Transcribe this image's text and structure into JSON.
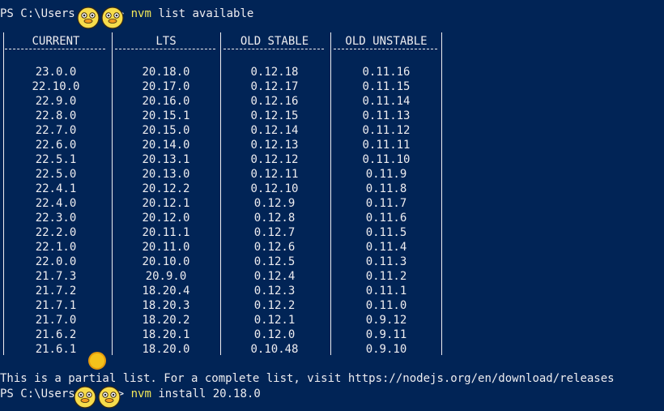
{
  "terminal": {
    "prompt_prefix": "PS C:\\Users",
    "prompt_suffix": ">",
    "command1": {
      "program": "nvm",
      "args": "list available"
    },
    "command2": {
      "program": "nvm",
      "args": "install 20.18.0"
    },
    "footer": "This is a partial list. For a complete list, visit https://nodejs.org/en/download/releases"
  },
  "table": {
    "headers": [
      "CURRENT",
      "LTS",
      "OLD STABLE",
      "OLD UNSTABLE"
    ],
    "rows": [
      [
        "23.0.0",
        "20.18.0",
        "0.12.18",
        "0.11.16"
      ],
      [
        "22.10.0",
        "20.17.0",
        "0.12.17",
        "0.11.15"
      ],
      [
        "22.9.0",
        "20.16.0",
        "0.12.16",
        "0.11.14"
      ],
      [
        "22.8.0",
        "20.15.1",
        "0.12.15",
        "0.11.13"
      ],
      [
        "22.7.0",
        "20.15.0",
        "0.12.14",
        "0.11.12"
      ],
      [
        "22.6.0",
        "20.14.0",
        "0.12.13",
        "0.11.11"
      ],
      [
        "22.5.1",
        "20.13.1",
        "0.12.12",
        "0.11.10"
      ],
      [
        "22.5.0",
        "20.13.0",
        "0.12.11",
        "0.11.9"
      ],
      [
        "22.4.1",
        "20.12.2",
        "0.12.10",
        "0.11.8"
      ],
      [
        "22.4.0",
        "20.12.1",
        "0.12.9",
        "0.11.7"
      ],
      [
        "22.3.0",
        "20.12.0",
        "0.12.8",
        "0.11.6"
      ],
      [
        "22.2.0",
        "20.11.1",
        "0.12.7",
        "0.11.5"
      ],
      [
        "22.1.0",
        "20.11.0",
        "0.12.6",
        "0.11.4"
      ],
      [
        "22.0.0",
        "20.10.0",
        "0.12.5",
        "0.11.3"
      ],
      [
        "21.7.3",
        "20.9.0",
        "0.12.4",
        "0.11.2"
      ],
      [
        "21.7.2",
        "18.20.4",
        "0.12.3",
        "0.11.1"
      ],
      [
        "21.7.1",
        "18.20.3",
        "0.12.2",
        "0.11.0"
      ],
      [
        "21.7.0",
        "18.20.2",
        "0.12.1",
        "0.9.12"
      ],
      [
        "21.6.2",
        "18.20.1",
        "0.12.0",
        "0.9.11"
      ],
      [
        "21.6.1",
        "18.20.0",
        "0.10.48",
        "0.9.10"
      ]
    ]
  },
  "colors": {
    "background": "#012456",
    "text": "#eeedf0",
    "command_highlight": "#f3e85a"
  },
  "icons": {
    "sticker": "duck-sticker-icon",
    "coin": "coin-icon"
  }
}
